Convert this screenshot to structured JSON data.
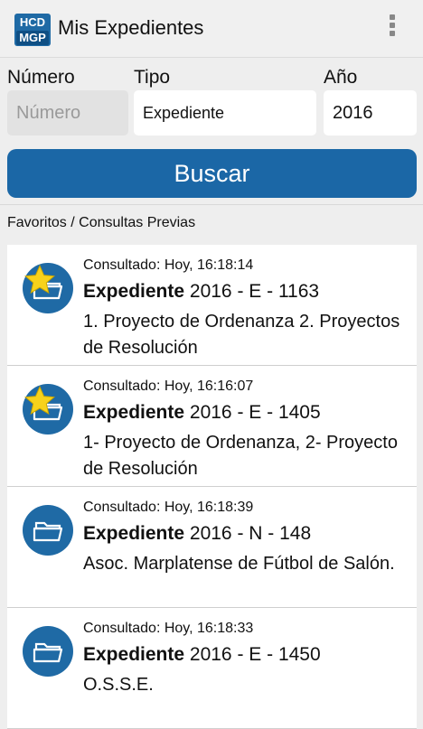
{
  "app": {
    "logo_top": "HCD",
    "logo_bottom": "MGP",
    "title": "Mis Expedientes"
  },
  "form": {
    "numero_label": "Número",
    "numero_placeholder": "Número",
    "tipo_label": "Tipo",
    "tipo_value": "Expediente",
    "anio_label": "Año",
    "anio_value": "2016",
    "buscar_label": "Buscar"
  },
  "section_label": "Favoritos / Consultas Previas",
  "items": [
    {
      "consultado": "Consultado: Hoy, 16:18:14",
      "tipo": "Expediente",
      "numero": "2016 - E - 1163",
      "descripcion": "1. Proyecto de Ordenanza 2. Proyectos de Resolución",
      "favorito": true
    },
    {
      "consultado": "Consultado: Hoy, 16:16:07",
      "tipo": "Expediente",
      "numero": "2016 - E - 1405",
      "descripcion": "1- Proyecto de Ordenanza, 2- Proyecto de Resolución",
      "favorito": true
    },
    {
      "consultado": "Consultado: Hoy, 16:18:39",
      "tipo": "Expediente",
      "numero": "2016 - N - 148",
      "descripcion": "Asoc. Marplatense de Fútbol de Salón.",
      "favorito": false
    },
    {
      "consultado": "Consultado: Hoy, 16:18:33",
      "tipo": "Expediente",
      "numero": "2016 - E - 1450",
      "descripcion": "O.S.S.E.",
      "favorito": false
    }
  ],
  "icons": {
    "overflow": "more-vert-icon",
    "folder": "folder-icon",
    "star": "star-icon"
  },
  "colors": {
    "brand_blue": "#1b67a6",
    "star_yellow": "#f7d21b"
  }
}
